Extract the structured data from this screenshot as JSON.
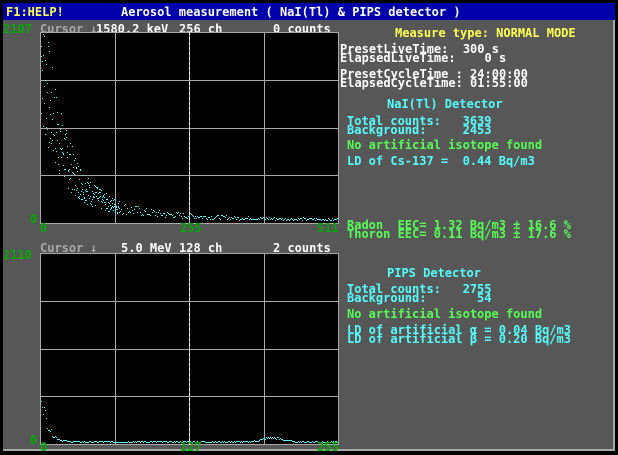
{
  "titlebar": {
    "help": "F1:HELP!",
    "title": "Aerosol measurement ( NaI(Tl) & PIPS detector )"
  },
  "top_spectrum": {
    "cursor_label": "Cursor",
    "cursor_energy": "1580.2 keV",
    "cursor_channel": "256 ch",
    "cursor_counts": "0 counts",
    "ymax": "2107",
    "ymin": "0",
    "xmin": "0",
    "xmid": "255",
    "xmax": "511",
    "cursor_fraction": 0.5
  },
  "bottom_spectrum": {
    "cursor_label": "Cursor",
    "cursor_energy": "5.0 MeV",
    "cursor_channel": "128 ch",
    "cursor_counts": "2 counts",
    "ymax": "2110",
    "ymin": "0",
    "xmin": "0",
    "xmid": "127",
    "xmax": "255",
    "cursor_fraction": 0.5
  },
  "status": {
    "measure_type": "Measure type: NORMAL MODE",
    "preset_live": "PresetLiveTime:  300 s",
    "elapsed_live": "ElapsedLiveTime:    0 s",
    "preset_cycle": "PresetCycleTime : 24:00:00",
    "elapsed_cycle": "ElapsedCycleTime: 01:55:00"
  },
  "nai": {
    "header": "NaI(Tl) Detector",
    "total_counts": "Total counts:   3639",
    "background": "Background:     2453",
    "isotope_msg": "No artificial isotope found",
    "ld_cs": "LD of Cs-137 =  0.44 Bq/m3",
    "radon": "Radon  EEC= 1.32 Bq/m3 ± 16.6 %",
    "thoron": "Thoron EEC= 0.11 Bq/m3 ± 17.6 %"
  },
  "pips": {
    "header": "PIPS Detector",
    "total_counts": "Total counts:   2755",
    "background": "Background:       54",
    "isotope_msg": "No artificial isotope found",
    "ld_alpha": "LD of artificial α = 0.04 Bq/m3",
    "ld_beta": "LD of artificial β = 0.20 Bq/m3"
  },
  "colors": {
    "frame": "#575757",
    "titlebar": "#0000aa",
    "grid": "#a8a8a8",
    "data": "#55ffff",
    "axis_labels": "#00aa00"
  }
}
